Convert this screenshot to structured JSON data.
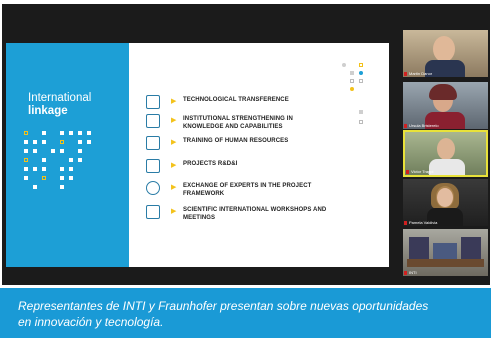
{
  "slide": {
    "title_line1": "International",
    "title_line2": "linkage",
    "items": [
      {
        "label": "TECHNOLOGICAL TRANSFERENCE",
        "icon": "network-icon"
      },
      {
        "label": "INSTITUTIONAL STRENGTHENING IN",
        "label2": "KNOWLEDGE AND CAPABILITIES",
        "icon": "building-icon"
      },
      {
        "label": "TRAINING OF HUMAN RESOURCES",
        "icon": "training-icon"
      },
      {
        "label": "PROJECTS R&D&I",
        "icon": "projects-icon"
      },
      {
        "label": "EXCHANGE OF EXPERTS IN THE PROJECT",
        "label2": "FRAMEWORK",
        "icon": "globe-icon"
      },
      {
        "label": "SCIENTIFIC INTERNATIONAL WORKSHOPS AND",
        "label2": "MEETINGS",
        "icon": "monitor-icon"
      }
    ]
  },
  "participants": [
    {
      "name": "Martin Danor",
      "muted": true
    },
    {
      "name": "Ursula Bristerelo",
      "muted": true
    },
    {
      "name": "Victor Trappi",
      "muted": true
    },
    {
      "name": "Pamela Valdivia",
      "muted": true
    },
    {
      "name": "INTI",
      "muted": true
    }
  ],
  "caption": {
    "line1": "Representantes de INTI y Fraunhofer presentan sobre nuevas oportunidades",
    "line2": "en innovación y tecnología."
  },
  "colors": {
    "slide_blue": "#1d9fd6",
    "caption_blue": "#1a9ad6",
    "accent_yellow": "#f3c21b"
  }
}
